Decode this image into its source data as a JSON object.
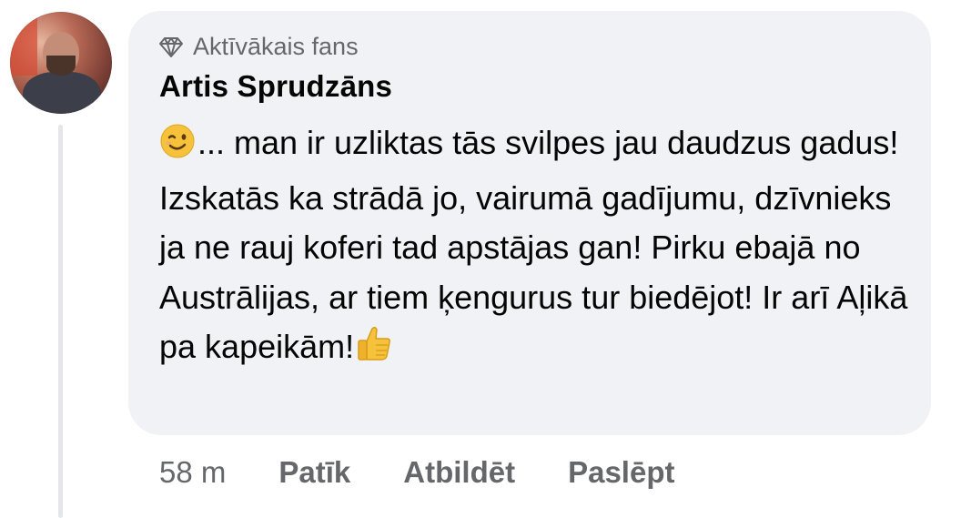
{
  "comment": {
    "badge_icon": "diamond-icon",
    "badge_label": "Aktīvākais fans",
    "author": "Artis Sprudzāns",
    "text_before_emoji": "",
    "emoji_start": "winking-face-emoji",
    "text_main": "... man ir uzliktas tās svilpes jau daudzus gadus! Izskatās ka strādā jo, vairumā gadījumu, dzīvnieks ja ne rauj koferi tad apstājas gan! Pirku ebajā no Austrālijas, ar tiem ķengurus tur biedējot! Ir arī Aļikā pa kapeikām!",
    "emoji_end": "thumbs-up-emoji"
  },
  "actions": {
    "time": "58 m",
    "like_label": "Patīk",
    "reply_label": "Atbildēt",
    "hide_label": "Paslēpt"
  },
  "colors": {
    "bubble": "#f0f2f5",
    "text": "#050505",
    "secondary": "#65676b",
    "thread_line": "#e4e6eb"
  }
}
